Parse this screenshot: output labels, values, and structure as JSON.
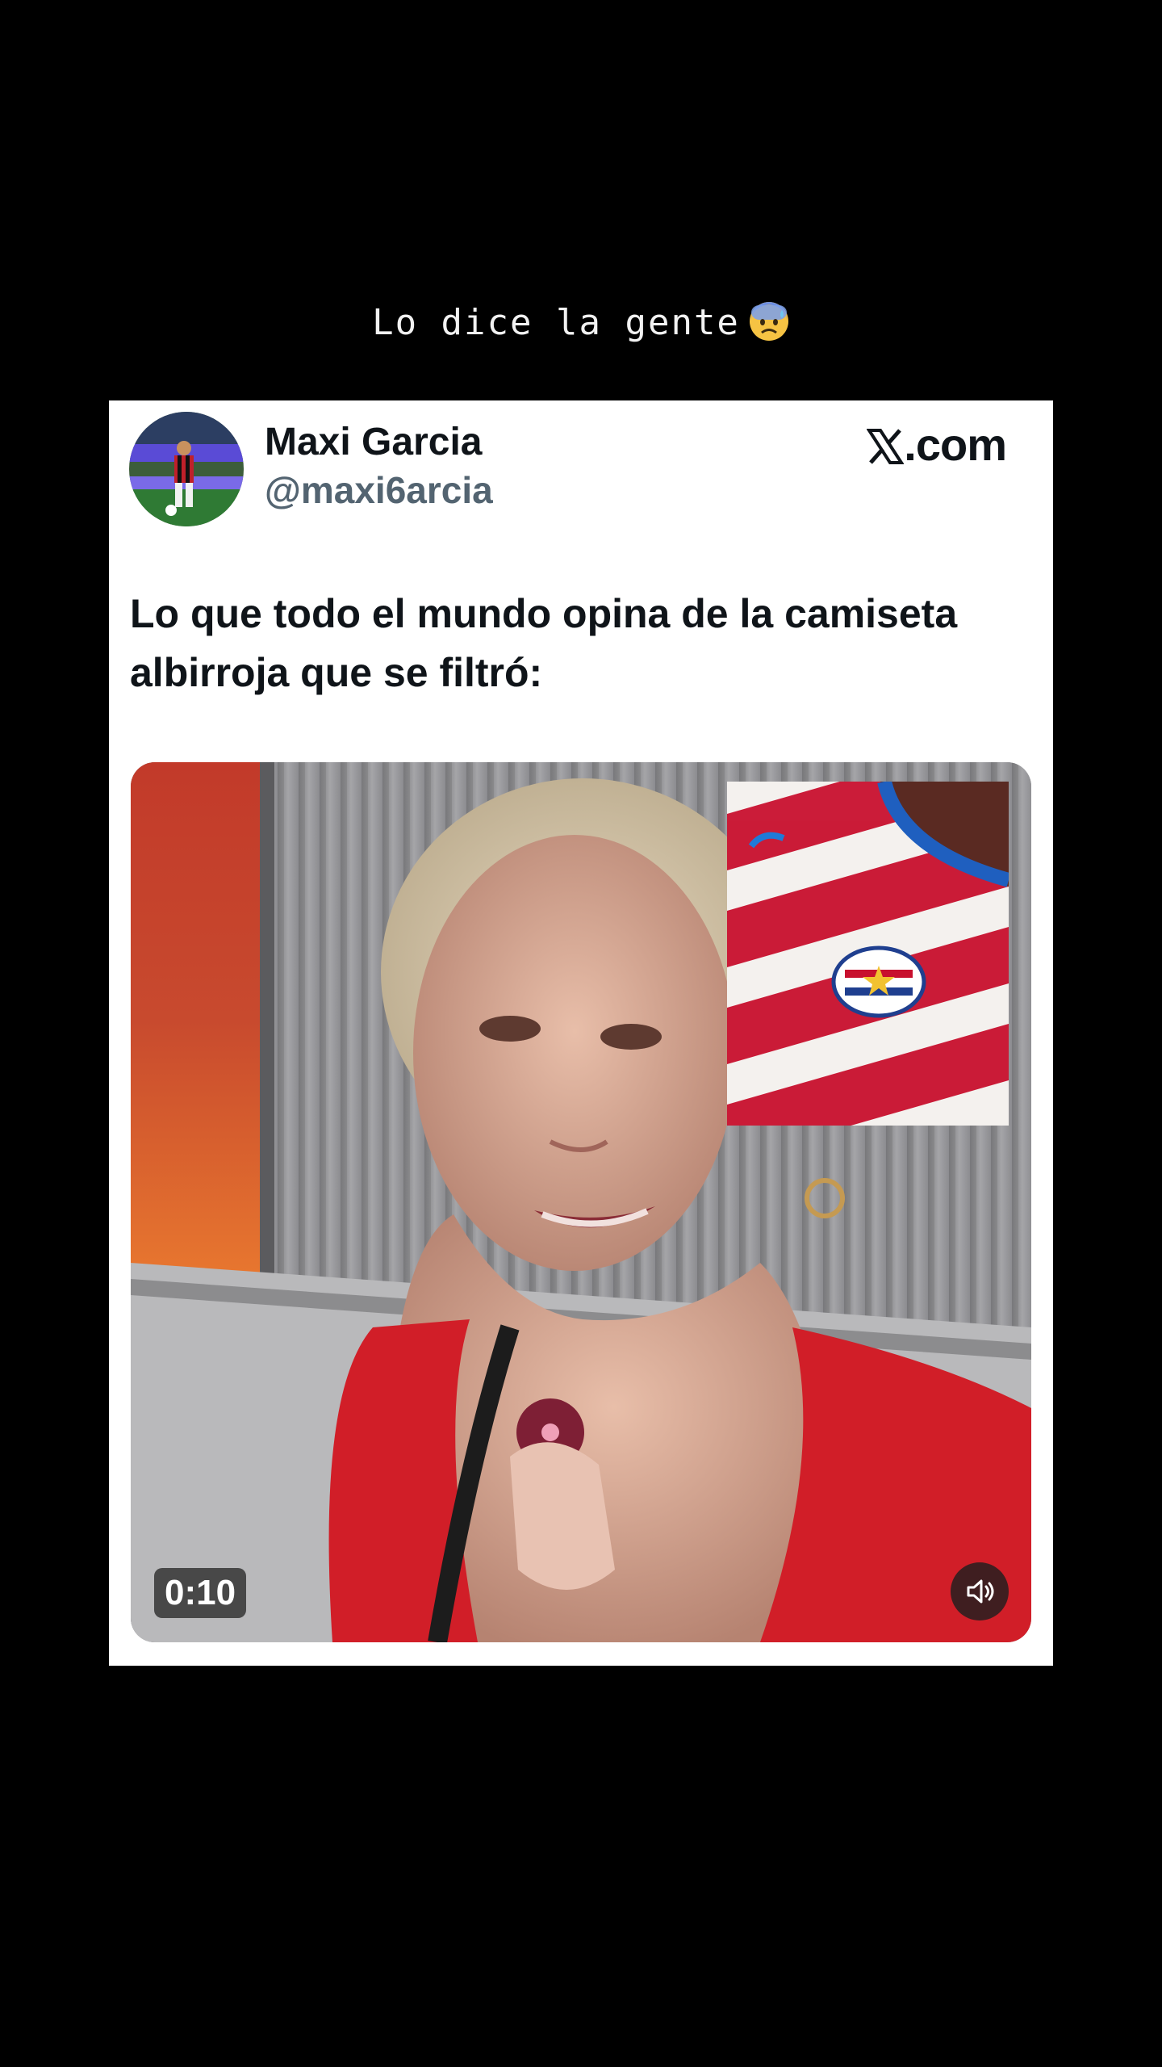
{
  "story": {
    "caption": "Lo dice la gente",
    "caption_emoji": "anxious-face-with-sweat-emoji"
  },
  "tweet": {
    "author_name": "Maxi Garcia",
    "author_handle": "@maxi6arcia",
    "brand": ".com",
    "brand_icon": "x-logo-icon",
    "text": "Lo que todo el mundo opina de la camiseta albirroja que se filtró:",
    "video": {
      "duration": "0:10",
      "mute_icon": "speaker-muted-icon"
    }
  },
  "colors": {
    "background": "#000000",
    "card": "#ffffff",
    "text_primary": "#0f1419",
    "text_secondary": "#536471",
    "shirt_red": "#c8102e",
    "shirt_blue": "#1f5fbf"
  }
}
